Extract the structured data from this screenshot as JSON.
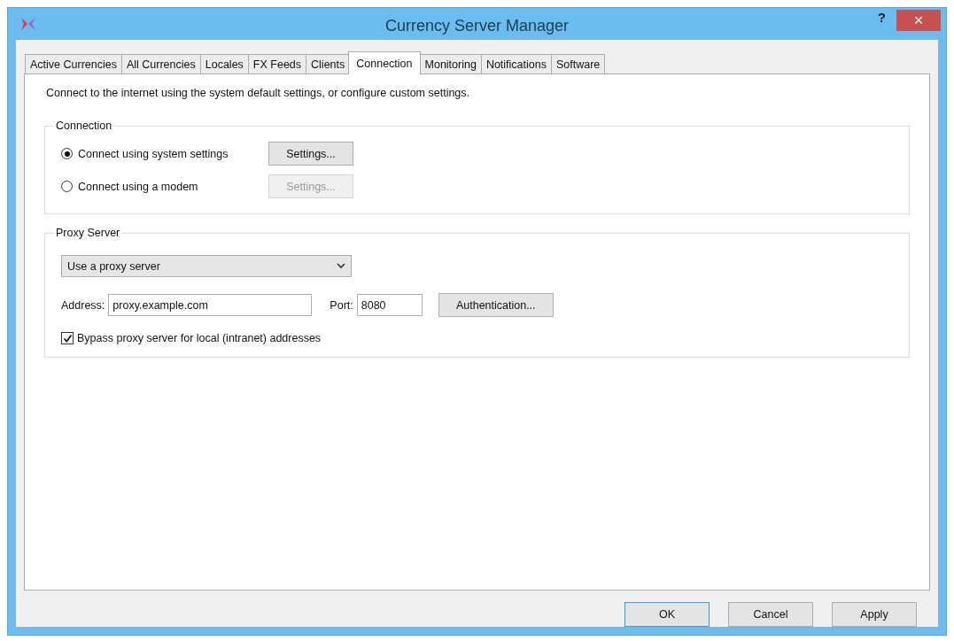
{
  "window": {
    "title": "Currency Server Manager",
    "help": "?",
    "close": "×"
  },
  "tabs": [
    {
      "label": "Active Currencies",
      "selected": false
    },
    {
      "label": "All Currencies",
      "selected": false
    },
    {
      "label": "Locales",
      "selected": false
    },
    {
      "label": "FX Feeds",
      "selected": false
    },
    {
      "label": "Clients",
      "selected": false
    },
    {
      "label": "Connection",
      "selected": true
    },
    {
      "label": "Monitoring",
      "selected": false
    },
    {
      "label": "Notifications",
      "selected": false
    },
    {
      "label": "Software",
      "selected": false
    }
  ],
  "intro": "Connect to the internet using the system default settings, or configure custom settings.",
  "connection": {
    "title": "Connection",
    "options": [
      {
        "label": "Connect using system settings",
        "selected": true,
        "button": {
          "label": "Settings...",
          "disabled": false
        }
      },
      {
        "label": "Connect using a modem",
        "selected": false,
        "button": {
          "label": "Settings...",
          "disabled": true
        }
      }
    ]
  },
  "proxy": {
    "title": "Proxy Server",
    "mode": "Use a proxy server",
    "address_label": "Address:",
    "address": "proxy.example.com",
    "port_label": "Port:",
    "port": "8080",
    "auth_button": "Authentication...",
    "bypass": {
      "label": "Bypass proxy server for local (intranet) addresses",
      "checked": true
    }
  },
  "buttons": [
    {
      "label": "OK",
      "default": true
    },
    {
      "label": "Cancel",
      "default": false
    },
    {
      "label": "Apply",
      "default": false
    }
  ]
}
